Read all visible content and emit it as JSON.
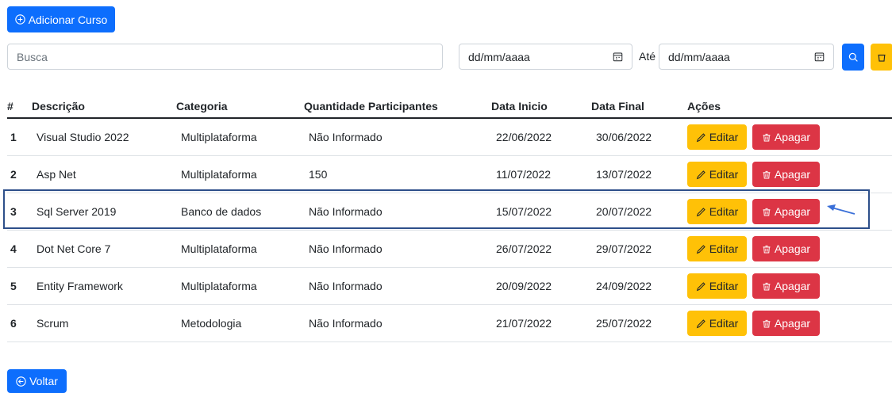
{
  "toolbar": {
    "add_label": "Adicionar Curso",
    "back_label": "Voltar"
  },
  "filters": {
    "search_placeholder": "Busca",
    "date_start_placeholder": "dd/mm/aaaa",
    "date_end_placeholder": "dd/mm/aaaa",
    "ate_label": "Até"
  },
  "table": {
    "headers": [
      "#",
      "Descrição",
      "Categoria",
      "Quantidade Participantes",
      "Data Inicio",
      "Data Final",
      "Ações"
    ],
    "edit_label": "Editar",
    "delete_label": "Apagar",
    "rows": [
      {
        "num": "1",
        "descricao": "Visual Studio 2022",
        "categoria": "Multiplataforma",
        "qtd": "Não Informado",
        "inicio": "22/06/2022",
        "final": "30/06/2022"
      },
      {
        "num": "2",
        "descricao": "Asp Net",
        "categoria": "Multiplataforma",
        "qtd": "150",
        "inicio": "11/07/2022",
        "final": "13/07/2022"
      },
      {
        "num": "3",
        "descricao": "Sql Server 2019",
        "categoria": "Banco de dados",
        "qtd": "Não Informado",
        "inicio": "15/07/2022",
        "final": "20/07/2022"
      },
      {
        "num": "4",
        "descricao": "Dot Net Core 7",
        "categoria": "Multiplataforma",
        "qtd": "Não Informado",
        "inicio": "26/07/2022",
        "final": "29/07/2022"
      },
      {
        "num": "5",
        "descricao": "Entity Framework",
        "categoria": "Multiplataforma",
        "qtd": "Não Informado",
        "inicio": "20/09/2022",
        "final": "24/09/2022"
      },
      {
        "num": "6",
        "descricao": "Scrum",
        "categoria": "Metodologia",
        "qtd": "Não Informado",
        "inicio": "21/07/2022",
        "final": "25/07/2022"
      }
    ]
  },
  "colors": {
    "primary": "#0d6efd",
    "warning": "#ffc107",
    "danger": "#dc3545",
    "highlight": "#2d4f8a"
  },
  "icons": {
    "add": "plus-circle-icon",
    "calendar": "calendar-icon",
    "search": "search-icon",
    "clear": "trash-icon",
    "edit": "pencil-icon",
    "delete": "trash-icon",
    "back": "arrow-left-circle-icon"
  }
}
